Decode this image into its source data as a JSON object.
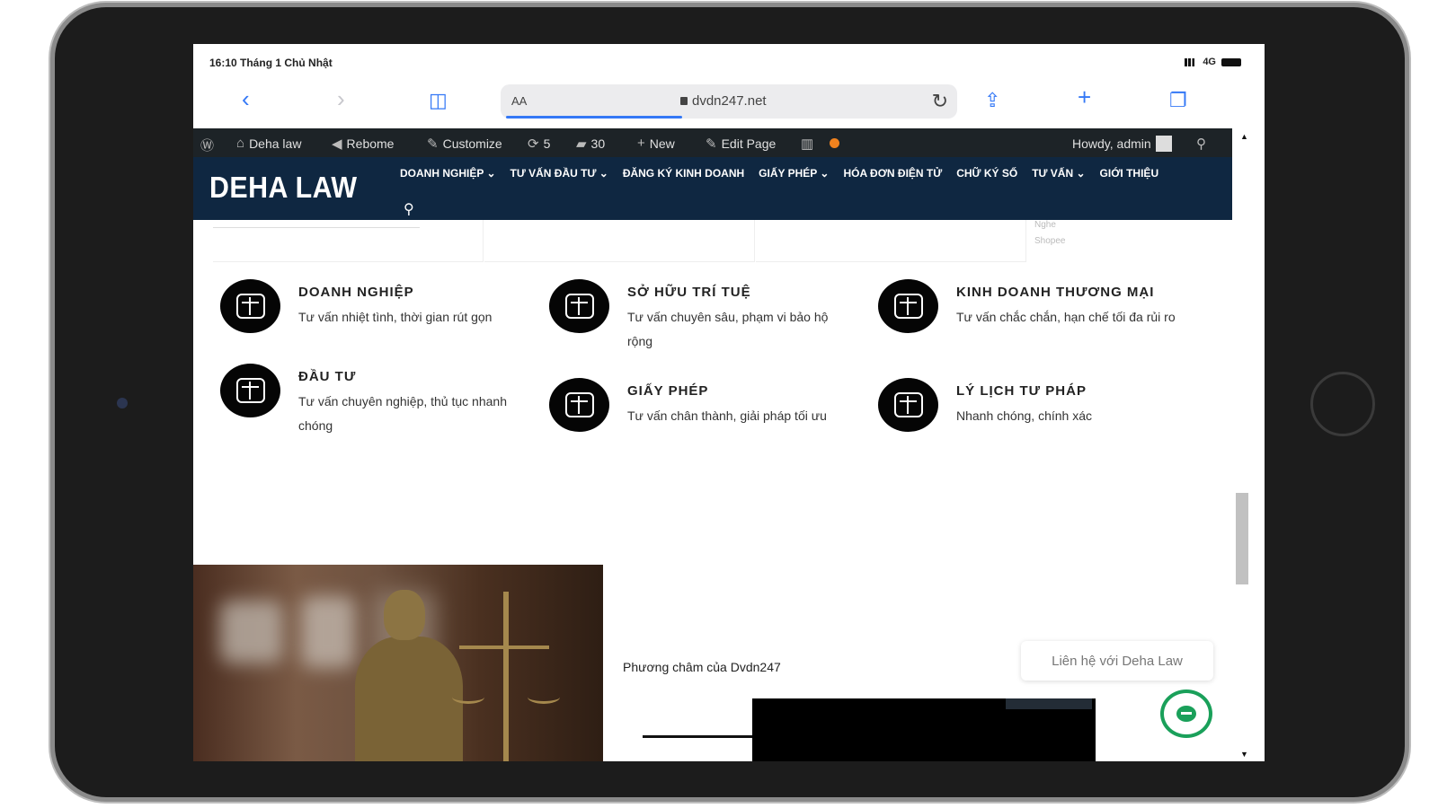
{
  "status_bar": {
    "time": "16:10 Tháng 1 Chủ Nhật",
    "network": "4G"
  },
  "browser": {
    "text_size_label": "AA",
    "url": "dvdn247.net",
    "icons": [
      "back-icon",
      "forward-icon",
      "bookmarks-icon",
      "reload-icon",
      "share-icon",
      "new-tab-icon",
      "tabs-icon"
    ]
  },
  "admin_bar": {
    "site_name": "Deha law",
    "rebrand": "Rebome",
    "customize": "Customize",
    "updates": "5",
    "comments": "30",
    "new": "New",
    "edit_page": "Edit Page",
    "howdy": "Howdy, admin"
  },
  "header": {
    "logo": "DEHA LAW",
    "nav": [
      "DOANH NGHIỆP ⌄",
      "TƯ VẤN ĐẦU TƯ ⌄",
      "ĐĂNG KÝ KINH DOANH",
      "GIẤY PHÉP ⌄",
      "HÓA ĐƠN ĐIỆN TỬ",
      "CHỮ KÝ SỐ",
      "TƯ VẤN ⌄",
      "GIỚI THIỆU"
    ]
  },
  "partial_text": {
    "a": "Nghe",
    "b": "Shopee"
  },
  "services": [
    {
      "title": "DOANH NGHIỆP",
      "desc": "Tư vấn nhiệt tình, thời gian rút gọn"
    },
    {
      "title": "SỞ HỮU TRÍ TUỆ",
      "desc": "Tư vấn chuyên sâu, phạm vi bảo hộ rộng"
    },
    {
      "title": "KINH DOANH THƯƠNG MẠI",
      "desc": "Tư vấn chắc chắn, hạn chế tối đa rủi ro"
    },
    {
      "title": "ĐẦU TƯ",
      "desc": "Tư vấn chuyên nghiệp, thủ tục nhanh chóng"
    },
    {
      "title": "GIẤY PHÉP",
      "desc": "Tư vấn chân thành, giải pháp tối ưu"
    },
    {
      "title": "LÝ LỊCH TƯ PHÁP",
      "desc": "Nhanh chóng, chính xác"
    }
  ],
  "motto": "Phương châm của Dvdn247",
  "contact_label": "Liên hệ với Deha Law",
  "colors": {
    "header_bg": "#0f2741",
    "admin_bar_bg": "#1d2327",
    "accent_blue": "#3478f6",
    "chat_green": "#1aa05a",
    "notification_dot": "#f0821e"
  }
}
